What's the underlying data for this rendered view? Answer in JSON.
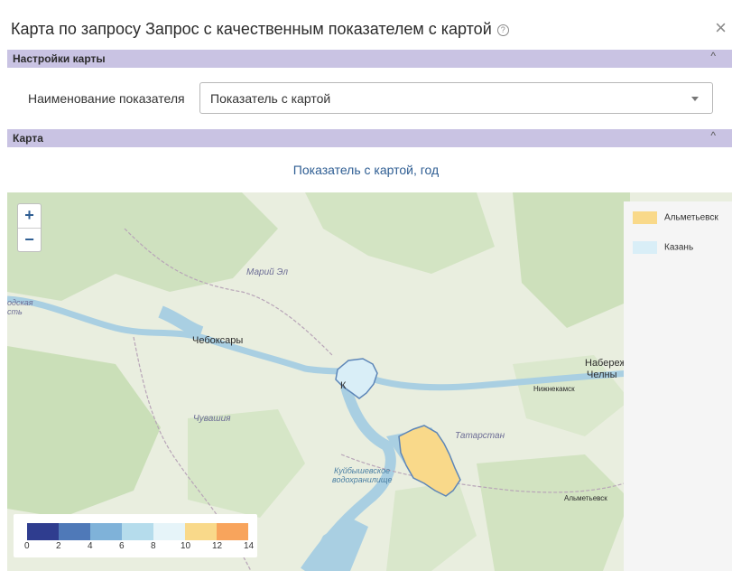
{
  "dialog": {
    "title": "Карта по запросу Запрос с качественным показателем с картой",
    "help_icon": "?",
    "close_icon": "×"
  },
  "settings_section": {
    "title": "Настройки карты",
    "chevron": "^"
  },
  "indicator": {
    "label": "Наименование показателя",
    "value": "Показатель с картой"
  },
  "map_section": {
    "title": "Карта",
    "chevron": "^"
  },
  "map": {
    "title": "Показатель с картой, год",
    "zoom_in": "+",
    "zoom_out": "−",
    "legend": [
      {
        "label": "Альметьевск",
        "color": "#f9d98a"
      },
      {
        "label": "Казань",
        "color": "#d9eef7"
      }
    ],
    "scale": {
      "colors": [
        "#2f3d8f",
        "#4f79b8",
        "#7fb2d9",
        "#b5dcec",
        "#e6f4f9",
        "#f9d98a",
        "#f8a45c"
      ],
      "ticks": [
        "0",
        "2",
        "4",
        "6",
        "8",
        "10",
        "12",
        "14"
      ]
    },
    "places": {
      "mari_el": "Марий Эл",
      "cheboksary": "Чебоксары",
      "chuvashia": "Чувашия",
      "tatarstan": "Татарстан",
      "naberezhnye_1": "Набережн",
      "naberezhnye_2": "Челны",
      "nizhnekamsk": "Нижнекамск",
      "almetyevsk": "Альметьевск",
      "kazan_label": "К",
      "reservoir_1": "Куйбышевское",
      "reservoir_2": "водохранилище",
      "edge_1": "одская",
      "edge_2": "сть"
    }
  }
}
